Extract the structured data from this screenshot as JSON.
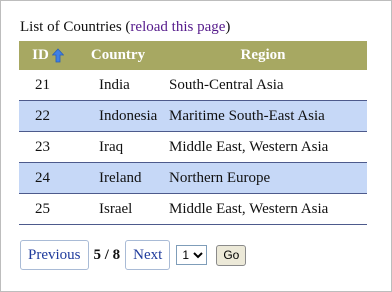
{
  "header": {
    "title": "List of Countries",
    "paren_open": " (",
    "reload_link": "reload this page",
    "paren_close": ")"
  },
  "table": {
    "columns": [
      "ID",
      "Country",
      "Region"
    ],
    "sort": {
      "column": "ID",
      "direction": "ascending",
      "icon": "sort-up-arrow-icon"
    },
    "rows": [
      {
        "id": "21",
        "country": "India",
        "region": "South-Central Asia"
      },
      {
        "id": "22",
        "country": "Indonesia",
        "region": "Maritime South-East Asia"
      },
      {
        "id": "23",
        "country": "Iraq",
        "region": "Middle East, Western Asia"
      },
      {
        "id": "24",
        "country": "Ireland",
        "region": "Northern Europe"
      },
      {
        "id": "25",
        "country": "Israel",
        "region": "Middle East, Western Asia"
      }
    ]
  },
  "pager": {
    "previous_label": "Previous",
    "page_info": "5 / 8",
    "next_label": "Next",
    "page_select_value": "1",
    "go_label": "Go"
  },
  "colors": {
    "header_bg": "#a7a862",
    "alt_row_bg": "#c6d8f7",
    "row_border": "#4d5a8c",
    "link": "#551a8b",
    "pager_link": "#1f3b9c"
  }
}
